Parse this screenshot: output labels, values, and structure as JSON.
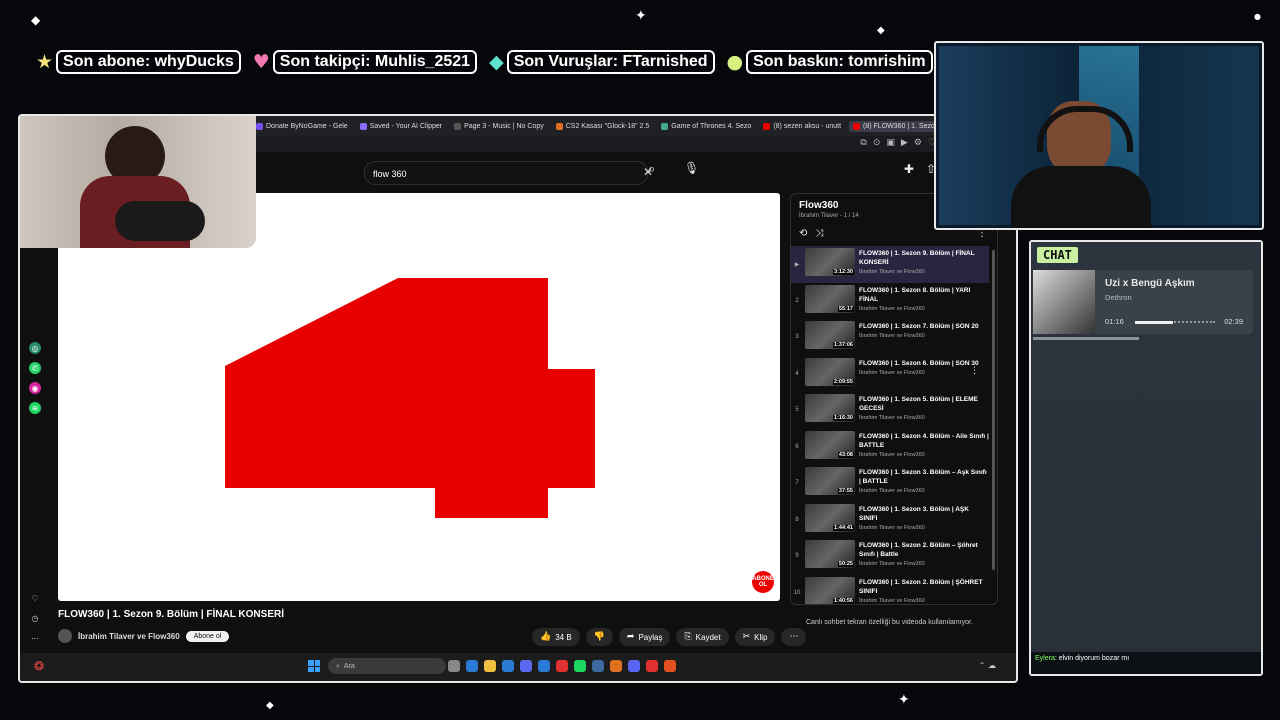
{
  "alerts": [
    {
      "icon_name": "star-icon",
      "icon_glyph": "★",
      "icon_color": "#f4e27a",
      "text": "Son abone: whyDucks"
    },
    {
      "icon_name": "heart-icon",
      "icon_glyph": "♥",
      "icon_color": "#f07ab0",
      "text": "Son takipçi: Muhlis_2521"
    },
    {
      "icon_name": "diamond-icon",
      "icon_glyph": "◆",
      "icon_color": "#5ee0d0",
      "text": "Son Vuruşlar: FTarnished"
    },
    {
      "icon_name": "orb-icon",
      "icon_glyph": "●",
      "icon_color": "#d8f080",
      "text": "Son baskın: tomrishim"
    }
  ],
  "browser": {
    "tabs": [
      {
        "label": "Donate ByNoGame - Gele",
        "color": "#7a4ff0",
        "active": false
      },
      {
        "label": "Saved - Your AI Clipper",
        "color": "#8a6cff",
        "active": false
      },
      {
        "label": "Page 3 - Music | No Copy",
        "color": "#555",
        "active": false
      },
      {
        "label": "CS2 Kasası \"Glock-18\" 2.5",
        "color": "#e07020",
        "active": false
      },
      {
        "label": "Game of Thrones 4. Sezo",
        "color": "#4a8",
        "active": false
      },
      {
        "label": "(8) sezen aksu - unutt",
        "color": "#e00",
        "active": false
      },
      {
        "label": "(8) FLOW360 | 1. Sezon 9.",
        "color": "#e00",
        "active": true
      }
    ],
    "add_tab": "+"
  },
  "youtube": {
    "search_value": "flow 360",
    "search_placeholder": "Ara",
    "video": {
      "title": "FLOW360 | 1. Sezon 9. Bölüm | FİNAL KONSERİ",
      "channel": "İbrahim Tilaver ve Flow360",
      "subscribe": "Abone ol",
      "badge": "ABONE OL",
      "frame_color": "#e80000"
    },
    "actions": {
      "likes": "34 B",
      "share": "Paylaş",
      "save": "Kaydet",
      "clip": "Klip"
    },
    "status_url": "https://www.youtube.com/watch?v=sWOgoqllgh0g&list=PLLgjJk07Cc_9AYnQwDFYKNkgiScaUX&index=4&pp=iAQB",
    "chat_disabled": "Canlı sohbet tekran özelliği bu videoda kullanılamıyor.",
    "playlist": {
      "title": "Flow360",
      "subtitle": "İbrahim Tilaver - 1 / 14",
      "items": [
        {
          "index": "▶",
          "title": "FLOW360 | 1. Sezon 9. Bölüm | FİNAL KONSERİ",
          "channel": "İbrahim Tilaver ve Flow360",
          "duration": "3:12:30",
          "current": true
        },
        {
          "index": "2",
          "title": "FLOW360 | 1. Sezon 8. Bölüm | YARI FİNAL",
          "channel": "İbrahim Tilaver ve Flow360",
          "duration": "55:17",
          "current": false
        },
        {
          "index": "3",
          "title": "FLOW360 | 1. Sezon 7. Bölüm | SON 20",
          "channel": "İbrahim Tilaver ve Flow360",
          "duration": "1:37:06",
          "current": false
        },
        {
          "index": "4",
          "title": "FLOW360 | 1. Sezon 6. Bölüm | SON 30",
          "channel": "İbrahim Tilaver ve Flow360",
          "duration": "2:09:55",
          "current": false
        },
        {
          "index": "5",
          "title": "FLOW360 | 1. Sezon 5. Bölüm | ELEME GECESİ",
          "channel": "İbrahim Tilaver ve Flow360",
          "duration": "1:16:30",
          "current": false
        },
        {
          "index": "6",
          "title": "FLOW360 | 1. Sezon 4. Bölüm - Aile Sınıfı | BATTLE",
          "channel": "İbrahim Tilaver ve Flow360",
          "duration": "43:08",
          "current": false
        },
        {
          "index": "7",
          "title": "FLOW360 | 1. Sezon 3. Bölüm – Aşk Sınıfı | BATTLE",
          "channel": "İbrahim Tilaver ve Flow360",
          "duration": "37:55",
          "current": false
        },
        {
          "index": "8",
          "title": "FLOW360 | 1. Sezon 3. Bölüm | AŞK SINIFI",
          "channel": "İbrahim Tilaver ve Flow360",
          "duration": "1:44:41",
          "current": false
        },
        {
          "index": "9",
          "title": "FLOW360 | 1. Sezon 2. Bölüm – Şöhret Sınıfı | Battle",
          "channel": "İbrahim Tilaver ve Flow360",
          "duration": "50:25",
          "current": false
        },
        {
          "index": "10",
          "title": "FLOW360 | 1. Sezon 2. Bölüm | ŞÖHRET SINIFI",
          "channel": "İbrahim Tilaver ve Flow360",
          "duration": "1:40:56",
          "current": false
        }
      ]
    }
  },
  "taskbar": {
    "search_placeholder": "Ara",
    "apps": [
      "#888",
      "#2b7ad6",
      "#f0c040",
      "#2b7ad6",
      "#5a6af0",
      "#2b7ad6",
      "#e03030",
      "#1ed760",
      "#3a6aa0",
      "#e07020",
      "#5865f2",
      "#e03030",
      "#e05020"
    ]
  },
  "chat": {
    "label": "CHAT",
    "music": {
      "title": "Uzi x Bengü Aşkım",
      "artist": "Dethron",
      "current": "01:16",
      "duration": "02:39",
      "progress": 0.48
    },
    "message_user": "Eylera",
    "message_text": ": elvin diyorum bozar mı"
  }
}
